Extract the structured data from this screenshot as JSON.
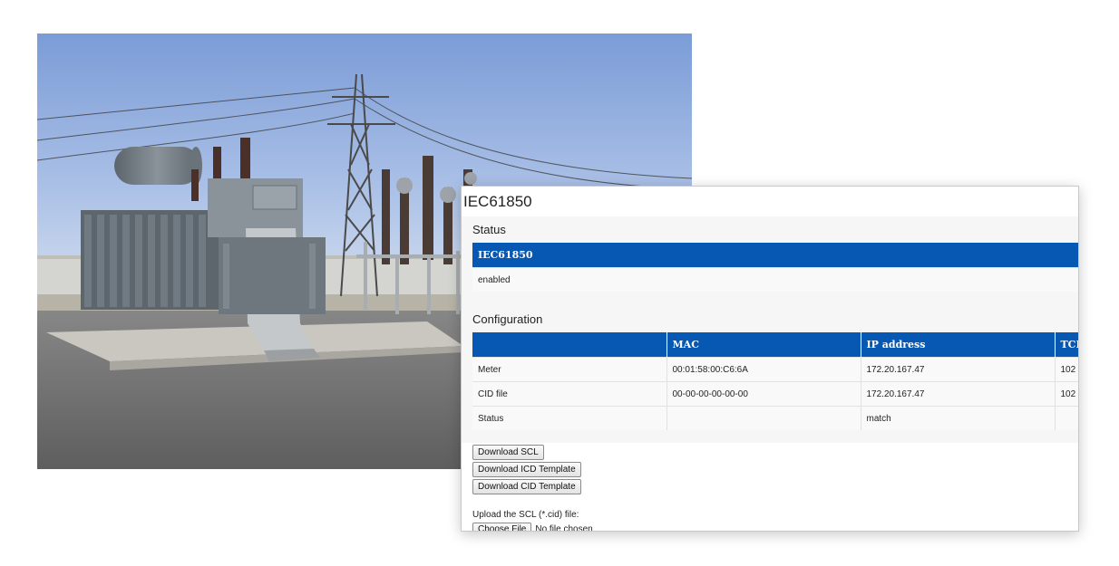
{
  "photo": {
    "subject": "power substation transformer",
    "colors": {
      "sky_top": "#7e9ed8",
      "sky_bottom": "#c3d3ec",
      "ground": "#6f6f6f",
      "transformer": "#7d858c"
    }
  },
  "page": {
    "title": "IEC61850"
  },
  "status": {
    "heading": "Status",
    "column": "IEC61850",
    "value": "enabled"
  },
  "configuration": {
    "heading": "Configuration",
    "columns": [
      "",
      "MAC",
      "IP address",
      "TCP port"
    ],
    "rows": [
      {
        "label": "Meter",
        "mac": "00:01:58:00:C6:6A",
        "ip": "172.20.167.47",
        "port": "102"
      },
      {
        "label": "CID file",
        "mac": "00-00-00-00-00-00",
        "ip": "172.20.167.47",
        "port": "102"
      },
      {
        "label": "Status",
        "mac": "",
        "ip": "match",
        "port": ""
      }
    ]
  },
  "actions": {
    "download_scl": "Download SCL",
    "download_icd": "Download ICD Template",
    "download_cid": "Download CID Template"
  },
  "upload": {
    "label": "Upload the SCL (*.cid) file:",
    "choose_button": "Choose File",
    "no_file": "No file chosen"
  },
  "colors": {
    "header_blue": "#0758b2",
    "section_bg": "#f6f6f6"
  }
}
